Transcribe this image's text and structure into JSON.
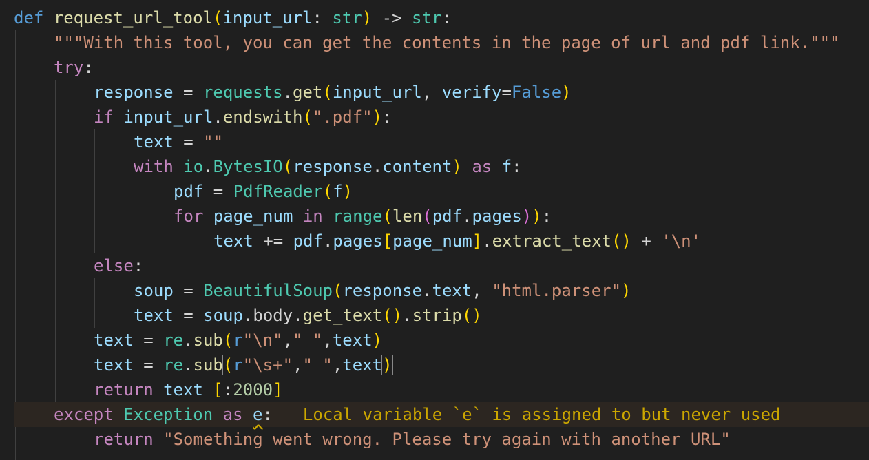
{
  "editor": {
    "language": "python",
    "lines": [
      "def request_url_tool(input_url: str) -> str:",
      "    \"\"\"With this tool, you can get the contents in the page of url and pdf link.\"\"\"",
      "    try:",
      "        response = requests.get(input_url, verify=False)",
      "        if input_url.endswith(\".pdf\"):",
      "            text = \"\"",
      "            with io.BytesIO(response.content) as f:",
      "                pdf = PdfReader(f)",
      "                for page_num in range(len(pdf.pages)):",
      "                    text += pdf.pages[page_num].extract_text() + '\\n'",
      "        else:",
      "            soup = BeautifulSoup(response.text, \"html.parser\")",
      "            text = soup.body.get_text().strip()",
      "        text = re.sub(r\"\\n\",\" \",text)",
      "        text = re.sub(r\"\\s+\",\" \",text)",
      "        return text [:2000]",
      "    except Exception as e:",
      "        return \"Something went wrong. Please try again with another URL\""
    ],
    "diagnostic": {
      "line": 17,
      "message": "Local variable `e` is assigned to but never used",
      "severity": "warning",
      "color": "#cca700"
    },
    "cursor_line": 15,
    "colors": {
      "background": "#1f1f1f",
      "keyword": "#569cd6",
      "control": "#c586c0",
      "function": "#dcdcaa",
      "variable": "#9cdcfe",
      "class": "#4ec9b0",
      "string": "#ce9178",
      "number": "#b5cea8"
    }
  },
  "tokens": {
    "l1": {
      "def": "def",
      "fname": "request_url_tool",
      "p1": "(",
      "param": "input_url",
      "colon": ": ",
      "type1": "str",
      "p2": ")",
      "arrow": " -> ",
      "type2": "str",
      "end": ":"
    },
    "l2": {
      "docstring": "\"\"\"With this tool, you can get the contents in the page of url and pdf link.\"\"\""
    },
    "l3": {
      "try": "try",
      "colon": ":"
    },
    "l4": {
      "response": "response",
      "eq": " = ",
      "requests": "requests",
      "dot": ".",
      "get": "get",
      "p1": "(",
      "input_url": "input_url",
      "comma": ", ",
      "verify": "verify",
      "eq2": "=",
      "false": "False",
      "p2": ")"
    },
    "l5": {
      "if": "if",
      "sp": " ",
      "input_url": "input_url",
      "dot": ".",
      "endswith": "endswith",
      "p1": "(",
      "str": "\".pdf\"",
      "p2": ")",
      "colon": ":"
    },
    "l6": {
      "text": "text",
      "eq": " = ",
      "str": "\"\""
    },
    "l7": {
      "with": "with",
      "sp": " ",
      "io": "io",
      "dot": ".",
      "BytesIO": "BytesIO",
      "p1": "(",
      "response": "response",
      "dot2": ".",
      "content": "content",
      "p2": ")",
      "sp2": " ",
      "as": "as",
      "sp3": " ",
      "f": "f",
      "colon": ":"
    },
    "l8": {
      "pdf": "pdf",
      "eq": " = ",
      "PdfReader": "PdfReader",
      "p1": "(",
      "f": "f",
      "p2": ")"
    },
    "l9": {
      "for": "for",
      "sp": " ",
      "page_num": "page_num",
      "sp2": " ",
      "in": "in",
      "sp3": " ",
      "range": "range",
      "p1": "(",
      "len": "len",
      "p2": "(",
      "pdf": "pdf",
      "dot": ".",
      "pages": "pages",
      "p3": ")",
      "p4": ")",
      "colon": ":"
    },
    "l10": {
      "text": "text",
      "op": " += ",
      "pdf": "pdf",
      "dot": ".",
      "pages": "pages",
      "b1": "[",
      "page_num": "page_num",
      "b2": "]",
      "dot2": ".",
      "extract_text": "extract_text",
      "p1": "()",
      "plus": " + ",
      "str": "'\\n'"
    },
    "l11": {
      "else": "else",
      "colon": ":"
    },
    "l12": {
      "soup": "soup",
      "eq": " = ",
      "BeautifulSoup": "BeautifulSoup",
      "p1": "(",
      "response": "response",
      "dot": ".",
      "text": "text",
      "comma": ", ",
      "str": "\"html.parser\"",
      "p2": ")"
    },
    "l13": {
      "text": "text",
      "eq": " = ",
      "soup": "soup",
      "dot": ".",
      "body": "body",
      "dot2": ".",
      "get_text": "get_text",
      "p1": "()",
      "dot3": ".",
      "strip": "strip",
      "p2": "()"
    },
    "l14": {
      "text": "text",
      "eq": " = ",
      "re": "re",
      "dot": ".",
      "sub": "sub",
      "p1": "(",
      "r": "r",
      "s1": "\"\\n\"",
      "comma": ",",
      "s2": "\" \"",
      "comma2": ",",
      "arg": "text",
      "p2": ")"
    },
    "l15": {
      "text": "text",
      "eq": " = ",
      "re": "re",
      "dot": ".",
      "sub": "sub",
      "p1": "(",
      "r": "r",
      "s1": "\"\\s+\"",
      "comma": ",",
      "s2": "\" \"",
      "comma2": ",",
      "arg": "text",
      "p2": ")"
    },
    "l16": {
      "return": "return",
      "sp": " ",
      "text": "text",
      "sp2": " ",
      "b1": "[",
      "colon": ":",
      "num": "2000",
      "b2": "]"
    },
    "l17": {
      "except": "except",
      "sp": " ",
      "Exception": "Exception",
      "sp2": " ",
      "as": "as",
      "sp3": " ",
      "e": "e",
      "colon": ":"
    },
    "l18": {
      "return": "return",
      "sp": " ",
      "str": "\"Something went wrong. Please try again with another URL\""
    }
  }
}
